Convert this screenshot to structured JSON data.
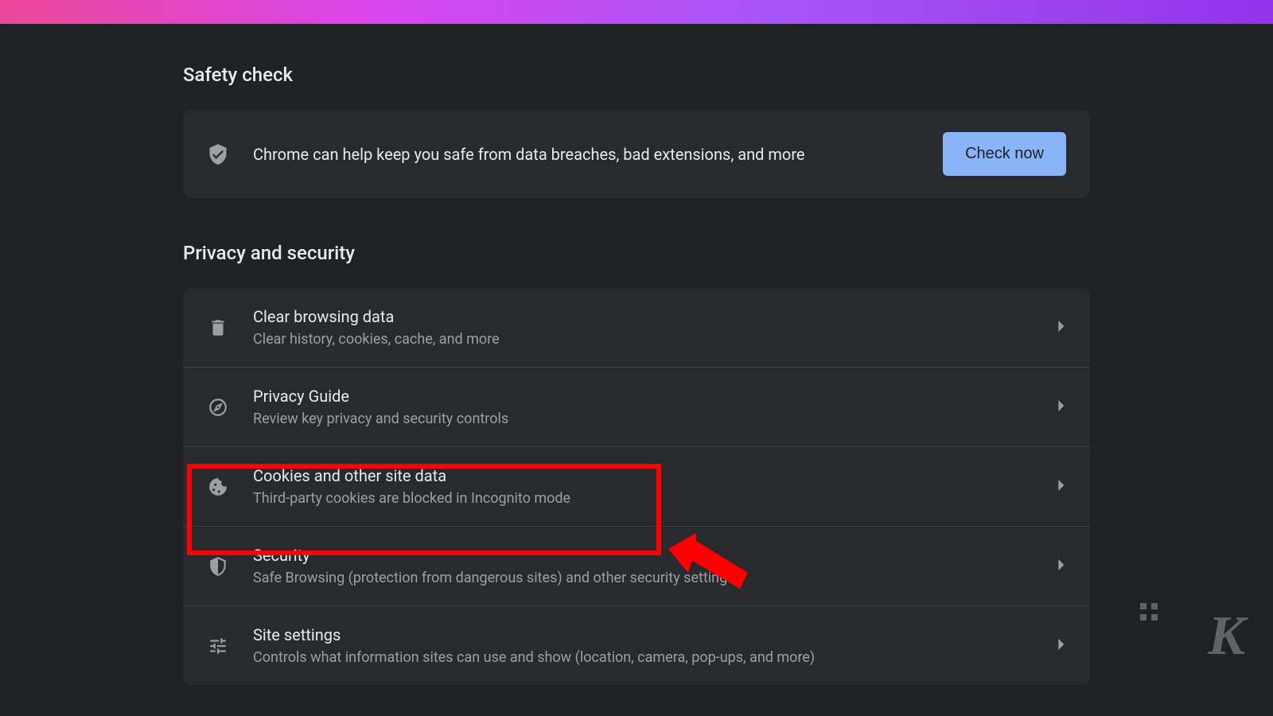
{
  "safety_check": {
    "title": "Safety check",
    "description": "Chrome can help keep you safe from data breaches, bad extensions, and more",
    "button": "Check now"
  },
  "privacy_security": {
    "title": "Privacy and security",
    "items": [
      {
        "title": "Clear browsing data",
        "subtitle": "Clear history, cookies, cache, and more"
      },
      {
        "title": "Privacy Guide",
        "subtitle": "Review key privacy and security controls"
      },
      {
        "title": "Cookies and other site data",
        "subtitle": "Third-party cookies are blocked in Incognito mode"
      },
      {
        "title": "Security",
        "subtitle": "Safe Browsing (protection from dangerous sites) and other security settings"
      },
      {
        "title": "Site settings",
        "subtitle": "Controls what information sites can use and show (location, camera, pop-ups, and more)"
      }
    ]
  }
}
